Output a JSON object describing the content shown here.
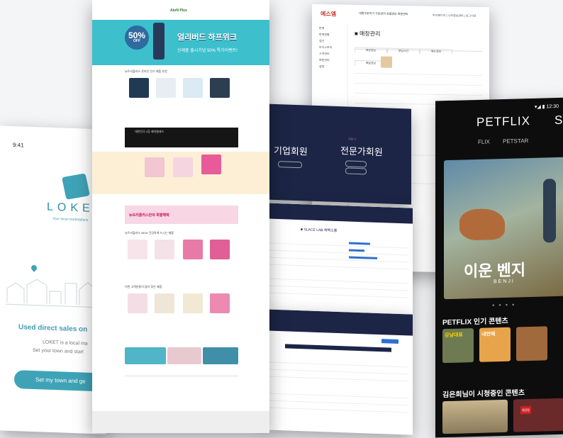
{
  "loket": {
    "time": "9:41",
    "logo": "LOKET",
    "tagline": "Your local marketplace",
    "heading": "Used direct sales on",
    "para1": "LOKET is a local ma",
    "para2": "Set your town and start",
    "button": "Set my town and ge"
  },
  "petflix": {
    "status": "▾◢ ▮ 12:30",
    "brand": "PETFLIX",
    "brand_cut": "SO",
    "tabs": [
      "FLIX",
      "PETSTAR"
    ],
    "featured_title": "이운 벤지",
    "featured_subtitle": "BENJI",
    "dots": "● ● ● ●",
    "section1": "PETFLIX 인기 콘텐츠",
    "thumbs": [
      "강남대표",
      "내안에",
      ""
    ],
    "section2": "김은희님이 시청중인 콘텐츠",
    "row2_badge": "하이"
  },
  "admin": {
    "logo": "에스엠",
    "nav": "대행주문하기   주문관리   상품관리   회원관리",
    "header": "마이페이지  |  나의정보관리  |  로그아웃",
    "side": [
      "판매",
      "판매현황",
      "정산",
      "마이스토어",
      "고객관리",
      "회원관리",
      "설정"
    ],
    "title": "■ 매장관리",
    "tabs": [
      "매장정보",
      "영업시간",
      "메뉴정보",
      "배달정보"
    ]
  },
  "dark": {
    "enterprise": "기업회원",
    "pro": "전문가회원",
    "small": "전문가"
  },
  "lab": {
    "head": "■ SLACE LAB   채택소통"
  },
  "shop": {
    "logo": "AtoN Plus",
    "badge_pct": "50%",
    "badge_off": "OFF",
    "banner_title": "얼리버드 하프위크",
    "banner_sub": "신제품 출시기념 50% 특가이벤트!",
    "sec1": "뉴트리플러스 온라인 인기 제품 추천",
    "sec2": "대한민국 1등 제약클래스",
    "promo": "뉴트리플러스만의 특별혜택",
    "sec3": "뉴트리플러스 NEW 건강하게 드시는 제품",
    "sec4": "이번 고객분들이 많이 찾은 제품"
  }
}
